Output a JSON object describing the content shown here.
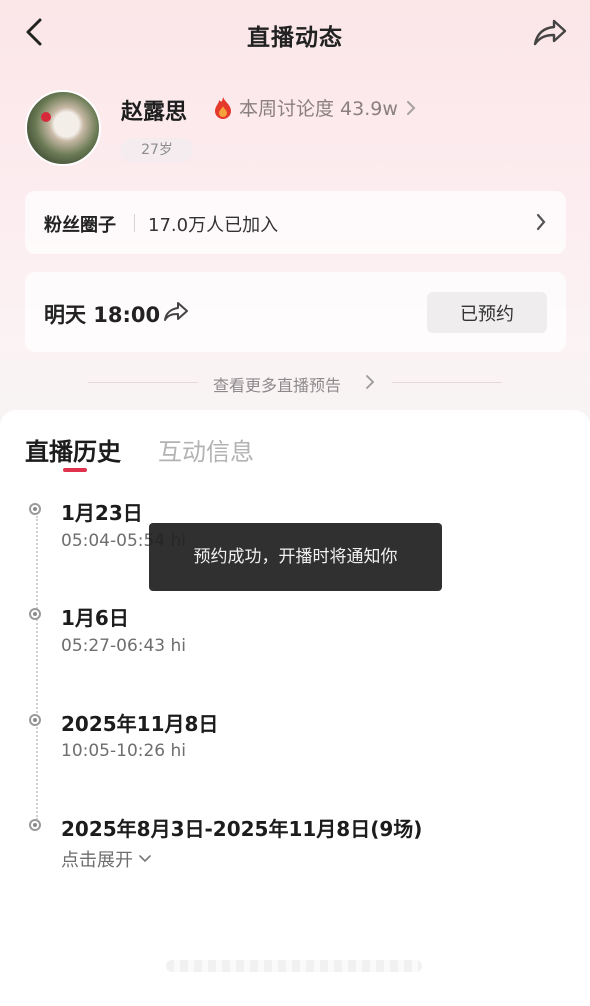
{
  "header": {
    "title": "直播动态",
    "back_icon": "chevron-left-icon",
    "share_icon": "share-icon"
  },
  "profile": {
    "name": "赵露思",
    "discussion_label": "本周讨论度 43.9w",
    "age_badge": "27岁"
  },
  "fans_circle": {
    "label": "粉丝圈子",
    "count": "17.0万人已加入"
  },
  "reservation": {
    "time": "明天 18:00",
    "button_label": "已预约"
  },
  "more_link": "查看更多直播预告",
  "tabs": [
    {
      "label": "直播历史",
      "active": true
    },
    {
      "label": "互动信息",
      "active": false
    }
  ],
  "history": [
    {
      "date": "1月23日",
      "time": "05:04-05:54 hi"
    },
    {
      "date": "1月6日",
      "time": "05:27-06:43 hi"
    },
    {
      "date": "2025年11月8日",
      "time": "10:05-10:26 hi"
    },
    {
      "date": "2025年8月3日-2025年11月8日(9场)",
      "time": ""
    }
  ],
  "expand_label": "点击展开",
  "toast": "预约成功，开播时将通知你",
  "colors": {
    "accent": "#e0314e",
    "page_gradient_top": "#fbe6e8"
  }
}
